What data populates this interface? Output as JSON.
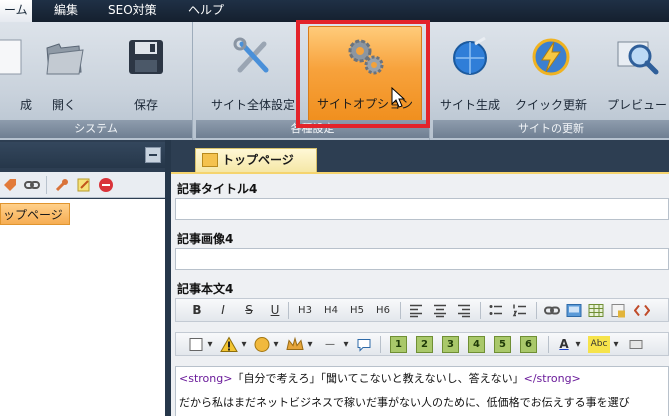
{
  "menubar": {
    "items": [
      {
        "label": "ーム",
        "active": true
      },
      {
        "label": "編集",
        "active": false
      },
      {
        "label": "SEO対策",
        "active": false
      },
      {
        "label": "ヘルプ",
        "active": false
      }
    ]
  },
  "ribbon": {
    "groups": [
      {
        "label": "システム",
        "buttons": [
          {
            "label": "成",
            "icon": "new-icon"
          },
          {
            "label": "開く",
            "icon": "folder-open-icon"
          },
          {
            "label": "保存",
            "icon": "floppy-disk-icon"
          }
        ]
      },
      {
        "label": "各種設定",
        "buttons": [
          {
            "label": "サイト全体設定",
            "icon": "site-settings-tools-icon"
          },
          {
            "label": "サイトオプション",
            "icon": "gears-icon"
          }
        ]
      },
      {
        "label": "サイトの更新",
        "buttons": [
          {
            "label": "サイト生成",
            "icon": "globe-generate-icon"
          },
          {
            "label": "クイック更新",
            "icon": "lightning-icon"
          },
          {
            "label": "プレビュー",
            "icon": "magnifier-preview-icon"
          }
        ]
      }
    ]
  },
  "left_panel": {
    "tree_item": "ップページ"
  },
  "editor": {
    "tab_label": "トップページ",
    "fields": {
      "title_label": "記事タイトル4",
      "image_label": "記事画像4",
      "body_label": "記事本文4"
    },
    "toolbar1": [
      "B",
      "I",
      "S",
      "U",
      "H3",
      "H4",
      "H5",
      "H6"
    ],
    "toolbar2_numbers": [
      "1",
      "2",
      "3",
      "4",
      "5",
      "6"
    ],
    "content": {
      "tag_open": "<strong>",
      "line1_text": "「自分で考えろ」「聞いてこないと教えないし、答えない」",
      "tag_close": "</strong>",
      "line2": "だから私はまだネットビジネスで稼いだ事がない人のために、低価格でお伝えする事を選び"
    }
  },
  "colors": {
    "accent_orange": "#f39a2b",
    "highlight_red": "#e3232a",
    "ribbon_bg": "#c9d2dc",
    "dark_bg": "#2d3e52"
  }
}
